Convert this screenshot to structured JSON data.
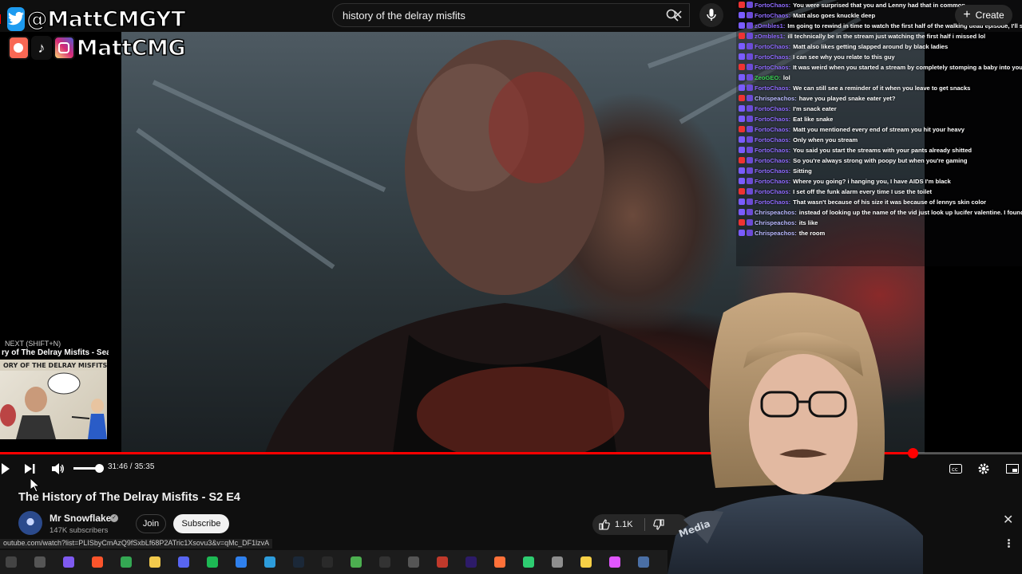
{
  "search": {
    "query": "history of the delray misfits"
  },
  "header": {
    "create_label": "Create"
  },
  "social": {
    "twitter_handle": "@MattCMGYT",
    "other_handle": "MattCMG"
  },
  "chat": {
    "lines": [
      {
        "user": "FortoChaos:",
        "text": "You were surprised that you and Lenny had that in common"
      },
      {
        "user": "FortoChaos:",
        "text": "Matt also goes knuckle deep"
      },
      {
        "user": "zOmbles1:",
        "text": "Im going to rewind in time to watch the first half of the walking dead episode, I'll see you in the future"
      },
      {
        "user": "zOmbles1:",
        "text": "ill technically be in the stream just watching the first half i missed lol"
      },
      {
        "user": "FortoChaos:",
        "text": "Matt also likes getting slapped around by black ladies"
      },
      {
        "user": "FortoChaos:",
        "text": "I can see why you relate to this guy"
      },
      {
        "user": "FortoChaos:",
        "text": "It was weird when you started a stream by completely stomping a baby into your carpet , but now I understand why you did it"
      },
      {
        "user": "ZeoGEO:",
        "text": "lol"
      },
      {
        "user": "FortoChaos:",
        "text": "We can still see a reminder of it when you leave to get snacks"
      },
      {
        "user": "Chrispeachos:",
        "text": "have you played snake eater yet?"
      },
      {
        "user": "FortoChaos:",
        "text": "I'm snack eater"
      },
      {
        "user": "FortoChaos:",
        "text": "Eat like snake"
      },
      {
        "user": "FortoChaos:",
        "text": "Matt you mentioned every end of stream you hit your heavy"
      },
      {
        "user": "FortoChaos:",
        "text": "Only when you stream"
      },
      {
        "user": "FortoChaos:",
        "text": "You said you start the streams with your pants already shitted"
      },
      {
        "user": "FortoChaos:",
        "text": "So you're always strong with poopy but when you're gaming"
      },
      {
        "user": "FortoChaos:",
        "text": "Sitting"
      },
      {
        "user": "FortoChaos:",
        "text": "Where you going? i hanging you, I have AIDS I'm black"
      },
      {
        "user": "FortoChaos:",
        "text": "I set off the funk alarm every time I use the toilet"
      },
      {
        "user": "FortoChaos:",
        "text": "That wasn't because of his size it was because of lennys skin color"
      },
      {
        "user": "Chrispeachos:",
        "text": "instead of looking up the name of the vid just look up lucifer valentine. I found out about it because theres an artist i like that said it was one of their favs"
      },
      {
        "user": "Chrispeachos:",
        "text": "its like"
      },
      {
        "user": "Chrispeachos:",
        "text": "the room"
      }
    ]
  },
  "next": {
    "label": "NEXT (SHIFT+N)",
    "title": "ry of The Delray Misfits - Sea..."
  },
  "player": {
    "time": "31:46 / 35:35",
    "progress": 0.893,
    "volume": 0.8
  },
  "video": {
    "title": "The History of The Delray Misfits - S2 E4",
    "channel": "Mr Snowflake",
    "subscribers": "147K subscribers",
    "join_label": "Join",
    "subscribe_label": "Subscribe",
    "likes": "1.1K"
  },
  "status_url": "outube.com/watch?list=PLISbyCmAzQ9fSxbLf68P2ATric1Xsovu3&v=qMc_DF1lzvA",
  "colors": {
    "accent": "#ff0000",
    "bg": "#0f0f0f"
  },
  "taskbar": {
    "icons": [
      "windows-terminal",
      "task-view",
      "copilot",
      "brave",
      "chrome",
      "files",
      "discord",
      "spotify",
      "droplet",
      "vscode",
      "steam",
      "epic",
      "minecraft",
      "obs",
      "github",
      "game",
      "premiere",
      "firefox",
      "games",
      "notes",
      "sticky-notes",
      "app",
      "steam-alt"
    ]
  }
}
